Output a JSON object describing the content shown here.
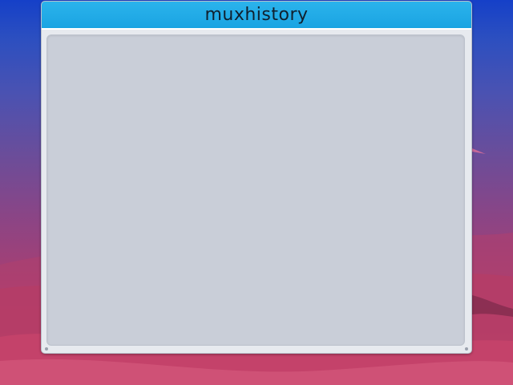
{
  "window": {
    "title": "muxhistory"
  },
  "colors": {
    "titlebar": "#1fa9e6",
    "window_bg": "#e7eaef",
    "content_bg": "#c9ced8",
    "title_text": "#10202e"
  }
}
